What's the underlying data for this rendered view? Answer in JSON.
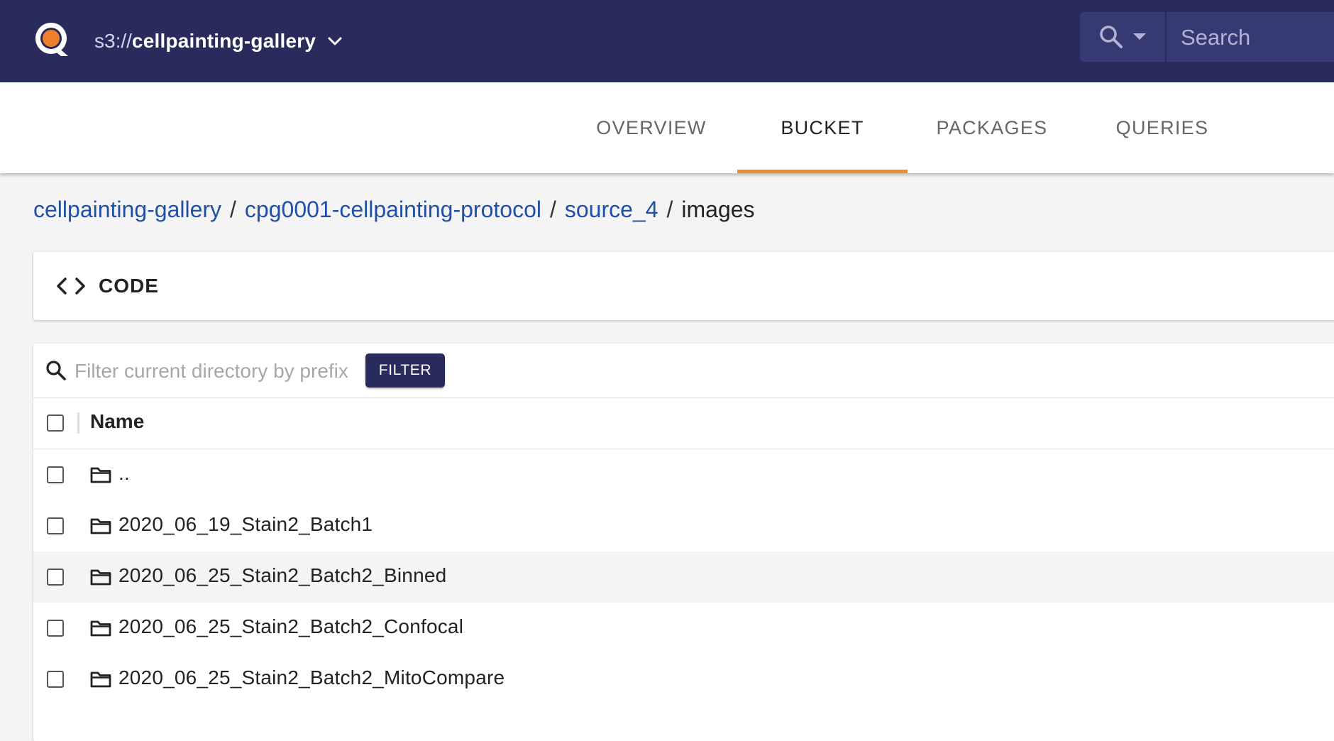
{
  "header": {
    "bucket_prefix": "s3://",
    "bucket_name": "cellpainting-gallery",
    "search_placeholder": "Search"
  },
  "tabs": [
    {
      "label": "OVERVIEW",
      "active": false
    },
    {
      "label": "BUCKET",
      "active": true
    },
    {
      "label": "PACKAGES",
      "active": false
    },
    {
      "label": "QUERIES",
      "active": false
    }
  ],
  "breadcrumb": {
    "links": [
      "cellpainting-gallery",
      "cpg0001-cellpainting-protocol",
      "source_4"
    ],
    "current": "images",
    "separator": "/"
  },
  "code_panel": {
    "label": "CODE"
  },
  "listing": {
    "filter_placeholder": "Filter current directory by prefix",
    "filter_button": "FILTER",
    "column_name": "Name",
    "rows": [
      "..",
      "2020_06_19_Stain2_Batch1",
      "2020_06_25_Stain2_Batch2_Binned",
      "2020_06_25_Stain2_Batch2_Confocal",
      "2020_06_25_Stain2_Batch2_MitoCompare"
    ]
  },
  "colors": {
    "header_bg": "#282b5c",
    "accent": "#f38b2a",
    "link": "#1f4fa8"
  }
}
